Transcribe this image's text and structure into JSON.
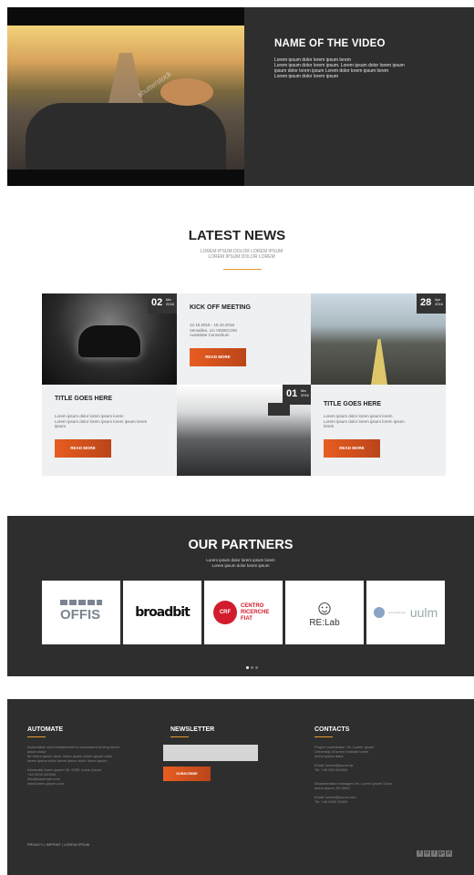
{
  "video": {
    "title": "NAME OF THE VIDEO",
    "description": "Lorem ipsum dolor lorem ipsum lorem\nLorem ipsum dolor lorem ipsum. Lorem ipsum dolor lorem ipsum\nipsum dolor lorem ipsum Lorem dolor lorem ipsum lorem\nLorem ipsum dolor lorem ipsum",
    "watermark": "shutterstock"
  },
  "news": {
    "title": "LATEST NEWS",
    "subtitle": "LOREM IPSUM DOLOR LOREM IPSUM\nLOREM IPSUM DOLOR LOREM",
    "accent": "#e39a2f",
    "tiles": [
      {
        "day": "02",
        "month": "Ma\n2016"
      },
      {
        "title": "KICK OFF MEETING",
        "text": "12.10.2015 - 16.10.2016\nVersailles, c/o VEDECOM\nAutoMate Consortium",
        "button": "READ MORE"
      },
      {
        "day": "28",
        "month": "Apr\n2016"
      },
      {
        "title": "TITLE GOES HERE",
        "text": "Lorem ipsum dolor lorem ipsum lorem\nLorem ipsum dolor lorem ipsum lorem ipsum lorem\nipsum",
        "button": "READ MORE"
      },
      {
        "day": "01",
        "month": "Ma\n2016"
      },
      {
        "title": "TITLE GOES HERE",
        "text": "Lorem ipsum dolor lorem ipsum lorem\nLorem ipsum dolor lorem ipsum lorem ipsum\nlorem",
        "button": "READ MORE"
      }
    ]
  },
  "partners": {
    "title": "OUR PARTNERS",
    "subtitle": "Lorem ipsum dolor lorem ipsum lorem\nLorem ipsum dolor lorem ipsum",
    "logos": [
      "OFFIS",
      "broadbit",
      "CENTRO RICERCHE FIAT",
      "RE:Lab",
      "uulm"
    ],
    "crf_badge": "CRF",
    "uulm_small": "universität ulm"
  },
  "footer": {
    "col1": {
      "title": "AUTOMATE",
      "text": "Automation and Infotainment for automated driving lorem ipsum dolor\nfor lorem ipsum dolor lorem ipsum lorem ipsum dolor\nlorem ipsum dolor lorem ipsum dolor lorem ipsum\n\nInformatic lorem ipsum 00, 0000, lorem ipsum\n+49 0000 000000\ninfo@automate.com\nwww.lorem-ipsum.com"
    },
    "col2": {
      "title": "NEWSLETTER",
      "input_placeholder": "",
      "button": "SUBSCRIBE"
    },
    "col3": {
      "title": "CONTACTS",
      "text": "Project coordinator: Dr. Lorem Ipsum\nUniversity of lorem Institute lorem\nlorem ipsum dolor\n\nEmail: lorem@ipsum.de\nTel: +49 000 000000\n\n\nDissemination manager: Mr. Lorem Ipsum Dolor\nlorem ipsum, 00 0000\n\nEmail: lorem@ipsum.com\nTel: +49 0000 00000"
    },
    "privacy": "PRIVACY | IMPRINT | LOREM IPSUM",
    "social": [
      "f",
      "in",
      "t",
      "g+",
      "yt"
    ]
  }
}
